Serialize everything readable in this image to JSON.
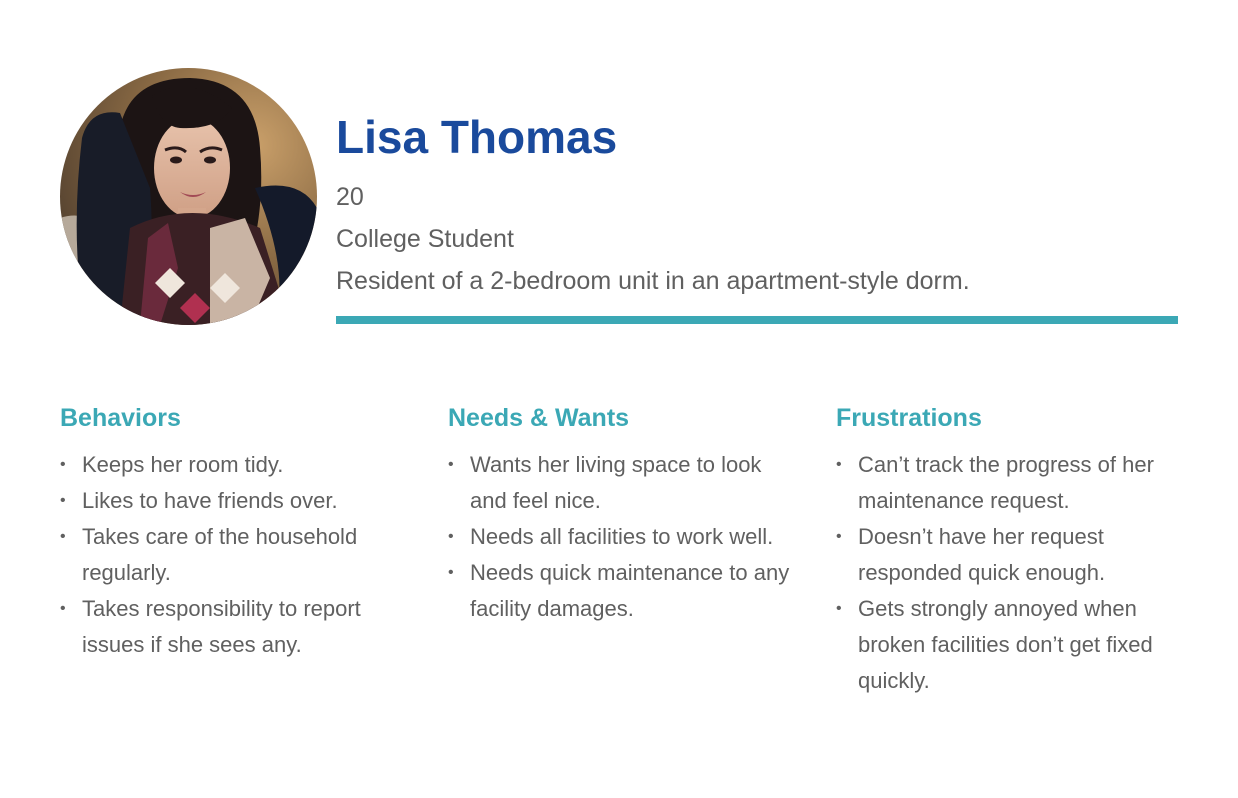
{
  "persona": {
    "name": "Lisa Thomas",
    "age": "20",
    "occupation": "College Student",
    "residence": "Resident of a 2-bedroom unit in an apartment-style dorm.",
    "photo": "portrait-photo"
  },
  "colors": {
    "name": "#1a4a9c",
    "accent": "#3ba8b5",
    "body_text": "#606060"
  },
  "sections": [
    {
      "heading": "Behaviors",
      "items": [
        "Keeps her room tidy.",
        "Likes to have friends over.",
        "Takes care of the household regularly.",
        "Takes responsibility to report issues if she sees any."
      ]
    },
    {
      "heading": "Needs & Wants",
      "items": [
        "Wants her living space to look and feel nice.",
        "Needs all facilities to work well.",
        "Needs quick maintenance to any facility damages."
      ]
    },
    {
      "heading": "Frustrations",
      "items": [
        "Can’t track the progress of her maintenance request.",
        "Doesn’t have her request responded quick enough.",
        "Gets strongly annoyed when broken facilities don’t get fixed quickly."
      ]
    }
  ]
}
